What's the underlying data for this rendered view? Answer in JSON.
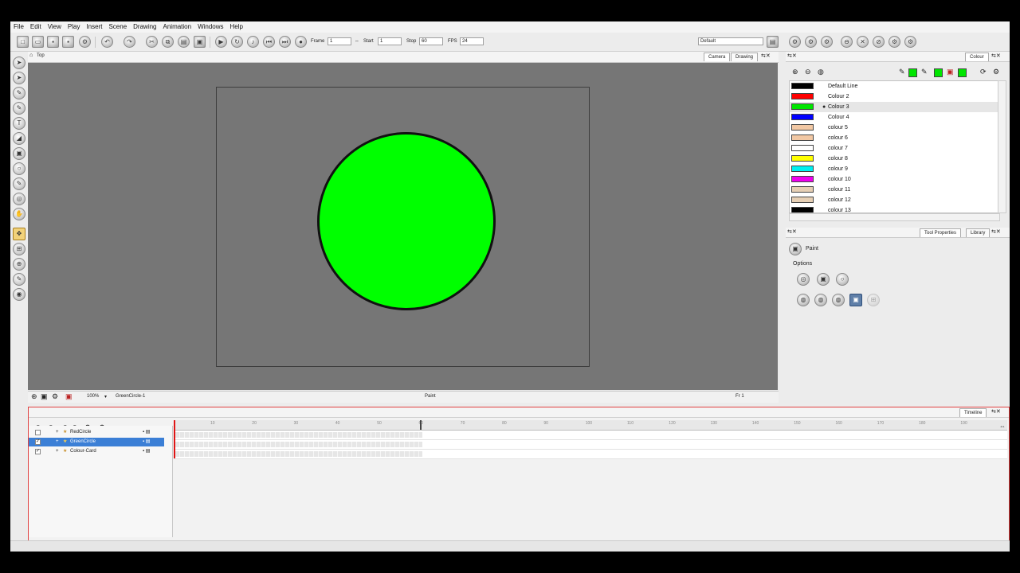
{
  "menu": [
    "File",
    "Edit",
    "View",
    "Play",
    "Insert",
    "Scene",
    "Drawing",
    "Animation",
    "Windows",
    "Help"
  ],
  "toolbar": {
    "frame_label": "Frame",
    "frame_value": "1",
    "start_label": "Start",
    "start_value": "1",
    "stop_label": "Stop",
    "stop_value": "60",
    "fps_label": "FPS",
    "fps_value": "24",
    "workspace_value": "Default"
  },
  "view": {
    "title": "Top",
    "tabs": [
      "Camera",
      "Drawing"
    ],
    "zoom": "100%",
    "drawing_name": "GreenCircle-1",
    "tool_name": "Paint",
    "frame_readout": "Fr 1"
  },
  "colour_panel": {
    "tab": "Colour",
    "selected_index": 2,
    "colours": [
      {
        "name": "Default Line",
        "hex": "#000000"
      },
      {
        "name": "Colour 2",
        "hex": "#ff0000"
      },
      {
        "name": "Colour 3",
        "hex": "#00e600"
      },
      {
        "name": "Colour 4",
        "hex": "#0000ff"
      },
      {
        "name": "colour 5",
        "hex": "#f2c8a4"
      },
      {
        "name": "colour 6",
        "hex": "#f2c8a4"
      },
      {
        "name": "colour 7",
        "hex": "#ffffff"
      },
      {
        "name": "colour 8",
        "hex": "#ffff00"
      },
      {
        "name": "colour 9",
        "hex": "#00f0f0"
      },
      {
        "name": "colour 10",
        "hex": "#ee00ee"
      },
      {
        "name": "colour 11",
        "hex": "#e6cfb4"
      },
      {
        "name": "colour 12",
        "hex": "#e6cfb4"
      },
      {
        "name": "colour 13",
        "hex": "#000000"
      }
    ]
  },
  "tool_properties": {
    "tabs": [
      "Tool Properties",
      "Library"
    ],
    "tool_name": "Paint",
    "options_label": "Options"
  },
  "timeline": {
    "tab": "Timeline",
    "layers": [
      {
        "name": "RedCircle",
        "checked": false,
        "selected": false
      },
      {
        "name": "GreenCircle",
        "checked": true,
        "selected": true
      },
      {
        "name": "Colour-Card",
        "checked": true,
        "selected": false
      }
    ],
    "ruler_ticks": [
      "10",
      "20",
      "30",
      "40",
      "50",
      "60",
      "70",
      "80",
      "90",
      "100",
      "110",
      "120",
      "130",
      "140",
      "150",
      "160",
      "170",
      "180",
      "190"
    ]
  },
  "colors": {
    "accent": "#3b7fd6",
    "timeline_border": "#e04040",
    "drawing_fill": "#00ff00",
    "viewport_bg": "#767676"
  }
}
